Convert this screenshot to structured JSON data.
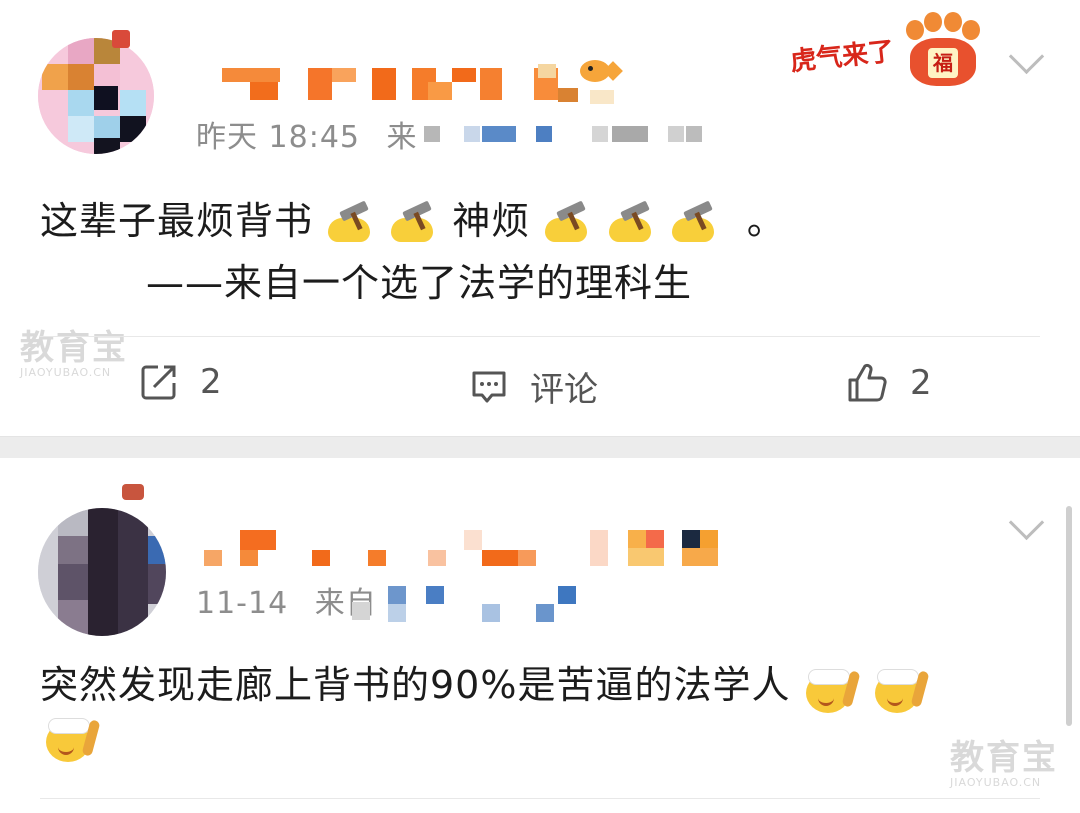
{
  "posts": [
    {
      "timestamp": "昨天 18:45",
      "source_prefix": "来",
      "line1": "这辈子最烦背书",
      "line1_mid": "神烦",
      "line1_end": "。",
      "line2": "——来自一个选了法学的理科生",
      "actions": {
        "repost_count": "2",
        "comment_label": "评论",
        "like_count": "2"
      },
      "badge_text": "虎气来了",
      "badge_char": "福"
    },
    {
      "timestamp": "11-14",
      "source_prefix": "来自",
      "line1": "突然发现走廊上背书的90%是苦逼的法学人"
    }
  ],
  "watermark": {
    "title": "教育宝",
    "url": "JIAOYUBAO.CN"
  },
  "icons": [
    "repost-icon",
    "comment-icon",
    "like-icon",
    "chevron-down-icon",
    "hammer-face-emoji",
    "cheer-face-emoji"
  ]
}
